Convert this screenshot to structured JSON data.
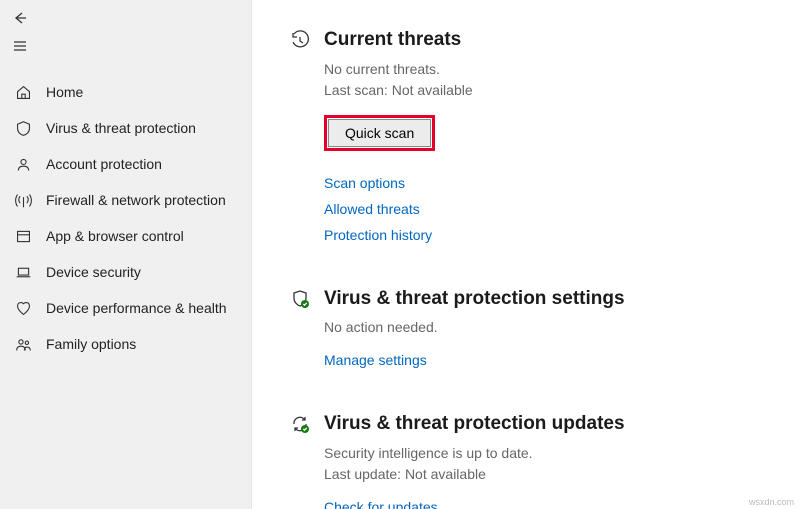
{
  "sidebar": {
    "items": [
      {
        "label": "Home"
      },
      {
        "label": "Virus & threat protection"
      },
      {
        "label": "Account protection"
      },
      {
        "label": "Firewall & network protection"
      },
      {
        "label": "App & browser control"
      },
      {
        "label": "Device security"
      },
      {
        "label": "Device performance & health"
      },
      {
        "label": "Family options"
      }
    ]
  },
  "threats": {
    "title": "Current threats",
    "line1": "No current threats.",
    "line2": "Last scan: Not available",
    "quick_scan_label": "Quick scan",
    "link_scan_options": "Scan options",
    "link_allowed_threats": "Allowed threats",
    "link_protection_history": "Protection history"
  },
  "settings": {
    "title": "Virus & threat protection settings",
    "desc": "No action needed.",
    "link_manage": "Manage settings"
  },
  "updates": {
    "title": "Virus & threat protection updates",
    "line1": "Security intelligence is up to date.",
    "line2": "Last update: Not available",
    "link_check": "Check for updates"
  },
  "watermark": "wsxdn.com"
}
